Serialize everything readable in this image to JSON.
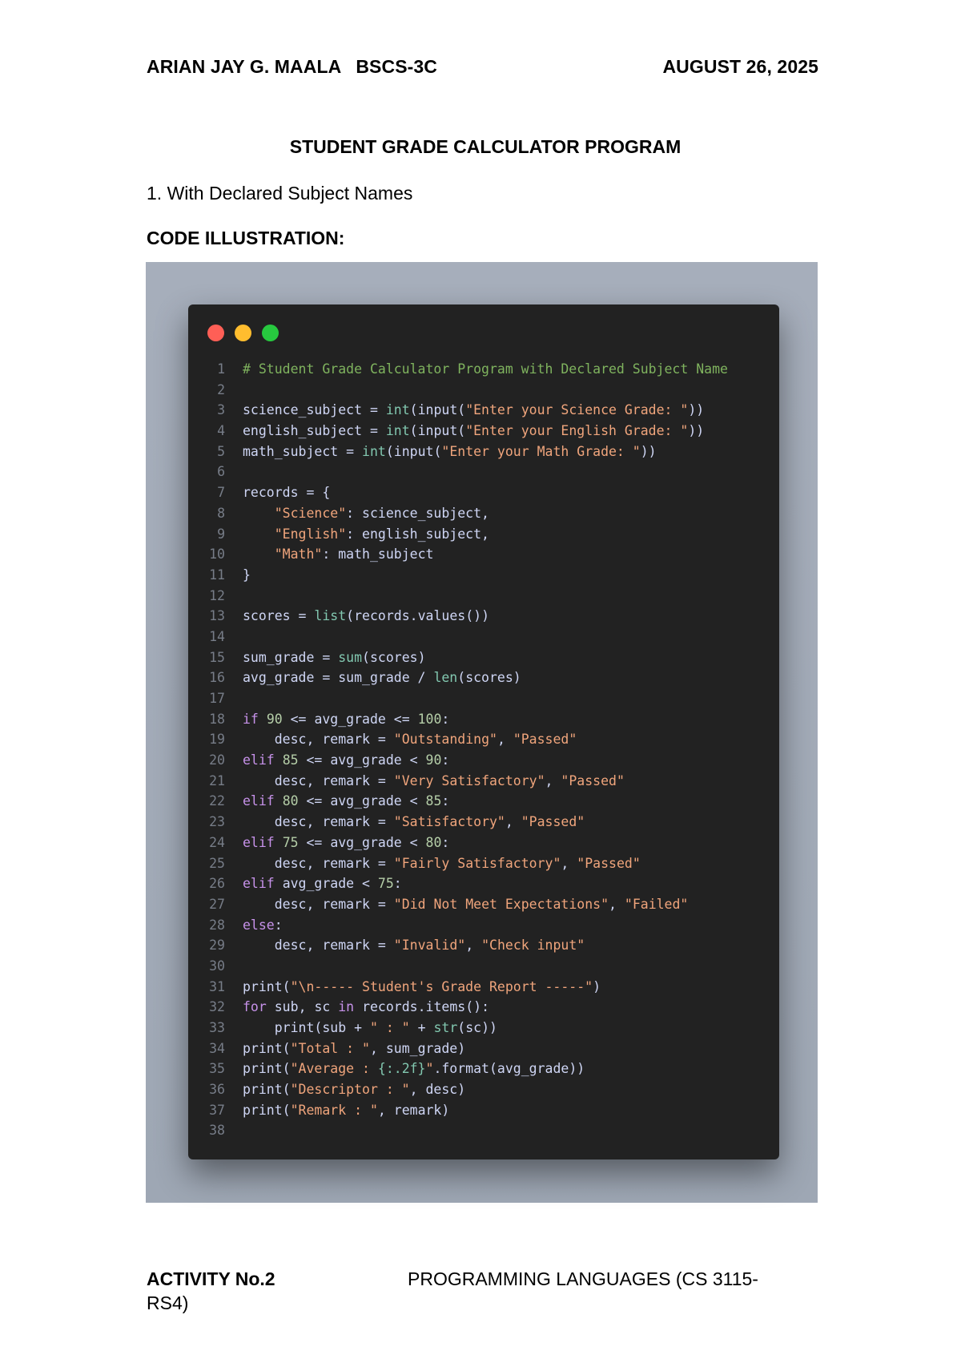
{
  "header": {
    "name": "ARIAN JAY G. MAALA",
    "course": "BSCS-3C",
    "date": "AUGUST 26, 2025"
  },
  "title": "STUDENT GRADE CALCULATOR PROGRAM",
  "section": "1. With Declared Subject Names",
  "code_heading": "CODE ILLUSTRATION:",
  "colors": {
    "window_bg": "#222222",
    "backdrop": "#a6aebb",
    "dot_red": "#ff5f56",
    "dot_yellow": "#ffbd2e",
    "dot_green": "#27c93f"
  },
  "code_lines": [
    [
      [
        "c",
        "# Student Grade Calculator Program with Declared Subject Name"
      ]
    ],
    [],
    [
      [
        "v",
        "science_subject"
      ],
      [
        "p",
        " = "
      ],
      [
        "f",
        "int"
      ],
      [
        "p",
        "("
      ],
      [
        "v",
        "input"
      ],
      [
        "p",
        "("
      ],
      [
        "s",
        "\"Enter your Science Grade: \""
      ],
      [
        "p",
        "))"
      ]
    ],
    [
      [
        "v",
        "english_subject"
      ],
      [
        "p",
        " = "
      ],
      [
        "f",
        "int"
      ],
      [
        "p",
        "("
      ],
      [
        "v",
        "input"
      ],
      [
        "p",
        "("
      ],
      [
        "s",
        "\"Enter your English Grade: \""
      ],
      [
        "p",
        "))"
      ]
    ],
    [
      [
        "v",
        "math_subject"
      ],
      [
        "p",
        " = "
      ],
      [
        "f",
        "int"
      ],
      [
        "p",
        "("
      ],
      [
        "v",
        "input"
      ],
      [
        "p",
        "("
      ],
      [
        "s",
        "\"Enter your Math Grade: \""
      ],
      [
        "p",
        "))"
      ]
    ],
    [],
    [
      [
        "v",
        "records"
      ],
      [
        "p",
        " = {"
      ]
    ],
    [
      [
        "p",
        "    "
      ],
      [
        "s",
        "\"Science\""
      ],
      [
        "p",
        ": "
      ],
      [
        "v",
        "science_subject"
      ],
      [
        "p",
        ","
      ]
    ],
    [
      [
        "p",
        "    "
      ],
      [
        "s",
        "\"English\""
      ],
      [
        "p",
        ": "
      ],
      [
        "v",
        "english_subject"
      ],
      [
        "p",
        ","
      ]
    ],
    [
      [
        "p",
        "    "
      ],
      [
        "s",
        "\"Math\""
      ],
      [
        "p",
        ": "
      ],
      [
        "v",
        "math_subject"
      ]
    ],
    [
      [
        "p",
        "}"
      ]
    ],
    [],
    [
      [
        "v",
        "scores"
      ],
      [
        "p",
        " = "
      ],
      [
        "f",
        "list"
      ],
      [
        "p",
        "("
      ],
      [
        "v",
        "records"
      ],
      [
        "p",
        "."
      ],
      [
        "v",
        "values"
      ],
      [
        "p",
        "())"
      ]
    ],
    [],
    [
      [
        "v",
        "sum_grade"
      ],
      [
        "p",
        " = "
      ],
      [
        "f",
        "sum"
      ],
      [
        "p",
        "("
      ],
      [
        "v",
        "scores"
      ],
      [
        "p",
        ")"
      ]
    ],
    [
      [
        "v",
        "avg_grade"
      ],
      [
        "p",
        " = "
      ],
      [
        "v",
        "sum_grade"
      ],
      [
        "p",
        " / "
      ],
      [
        "f",
        "len"
      ],
      [
        "p",
        "("
      ],
      [
        "v",
        "scores"
      ],
      [
        "p",
        ")"
      ]
    ],
    [],
    [
      [
        "k",
        "if"
      ],
      [
        "p",
        " "
      ],
      [
        "n",
        "90"
      ],
      [
        "p",
        " <= "
      ],
      [
        "v",
        "avg_grade"
      ],
      [
        "p",
        " <= "
      ],
      [
        "n",
        "100"
      ],
      [
        "p",
        ":"
      ]
    ],
    [
      [
        "p",
        "    "
      ],
      [
        "v",
        "desc"
      ],
      [
        "p",
        ", "
      ],
      [
        "v",
        "remark"
      ],
      [
        "p",
        " = "
      ],
      [
        "s",
        "\"Outstanding\""
      ],
      [
        "p",
        ", "
      ],
      [
        "s",
        "\"Passed\""
      ]
    ],
    [
      [
        "k",
        "elif"
      ],
      [
        "p",
        " "
      ],
      [
        "n",
        "85"
      ],
      [
        "p",
        " <= "
      ],
      [
        "v",
        "avg_grade"
      ],
      [
        "p",
        " < "
      ],
      [
        "n",
        "90"
      ],
      [
        "p",
        ":"
      ]
    ],
    [
      [
        "p",
        "    "
      ],
      [
        "v",
        "desc"
      ],
      [
        "p",
        ", "
      ],
      [
        "v",
        "remark"
      ],
      [
        "p",
        " = "
      ],
      [
        "s",
        "\"Very Satisfactory\""
      ],
      [
        "p",
        ", "
      ],
      [
        "s",
        "\"Passed\""
      ]
    ],
    [
      [
        "k",
        "elif"
      ],
      [
        "p",
        " "
      ],
      [
        "n",
        "80"
      ],
      [
        "p",
        " <= "
      ],
      [
        "v",
        "avg_grade"
      ],
      [
        "p",
        " < "
      ],
      [
        "n",
        "85"
      ],
      [
        "p",
        ":"
      ]
    ],
    [
      [
        "p",
        "    "
      ],
      [
        "v",
        "desc"
      ],
      [
        "p",
        ", "
      ],
      [
        "v",
        "remark"
      ],
      [
        "p",
        " = "
      ],
      [
        "s",
        "\"Satisfactory\""
      ],
      [
        "p",
        ", "
      ],
      [
        "s",
        "\"Passed\""
      ]
    ],
    [
      [
        "k",
        "elif"
      ],
      [
        "p",
        " "
      ],
      [
        "n",
        "75"
      ],
      [
        "p",
        " <= "
      ],
      [
        "v",
        "avg_grade"
      ],
      [
        "p",
        " < "
      ],
      [
        "n",
        "80"
      ],
      [
        "p",
        ":"
      ]
    ],
    [
      [
        "p",
        "    "
      ],
      [
        "v",
        "desc"
      ],
      [
        "p",
        ", "
      ],
      [
        "v",
        "remark"
      ],
      [
        "p",
        " = "
      ],
      [
        "s",
        "\"Fairly Satisfactory\""
      ],
      [
        "p",
        ", "
      ],
      [
        "s",
        "\"Passed\""
      ]
    ],
    [
      [
        "k",
        "elif"
      ],
      [
        "p",
        " "
      ],
      [
        "v",
        "avg_grade"
      ],
      [
        "p",
        " < "
      ],
      [
        "n",
        "75"
      ],
      [
        "p",
        ":"
      ]
    ],
    [
      [
        "p",
        "    "
      ],
      [
        "v",
        "desc"
      ],
      [
        "p",
        ", "
      ],
      [
        "v",
        "remark"
      ],
      [
        "p",
        " = "
      ],
      [
        "s",
        "\"Did Not Meet Expectations\""
      ],
      [
        "p",
        ", "
      ],
      [
        "s",
        "\"Failed\""
      ]
    ],
    [
      [
        "k",
        "else"
      ],
      [
        "p",
        ":"
      ]
    ],
    [
      [
        "p",
        "    "
      ],
      [
        "v",
        "desc"
      ],
      [
        "p",
        ", "
      ],
      [
        "v",
        "remark"
      ],
      [
        "p",
        " = "
      ],
      [
        "s",
        "\"Invalid\""
      ],
      [
        "p",
        ", "
      ],
      [
        "s",
        "\"Check input\""
      ]
    ],
    [],
    [
      [
        "v",
        "print"
      ],
      [
        "p",
        "("
      ],
      [
        "s",
        "\"\\n----- Student's Grade Report -----\""
      ],
      [
        "p",
        ")"
      ]
    ],
    [
      [
        "k",
        "for"
      ],
      [
        "p",
        " "
      ],
      [
        "v",
        "sub"
      ],
      [
        "p",
        ", "
      ],
      [
        "v",
        "sc"
      ],
      [
        "p",
        " "
      ],
      [
        "k",
        "in"
      ],
      [
        "p",
        " "
      ],
      [
        "v",
        "records"
      ],
      [
        "p",
        "."
      ],
      [
        "v",
        "items"
      ],
      [
        "p",
        "():"
      ]
    ],
    [
      [
        "p",
        "    "
      ],
      [
        "v",
        "print"
      ],
      [
        "p",
        "("
      ],
      [
        "v",
        "sub"
      ],
      [
        "p",
        " + "
      ],
      [
        "s",
        "\" : \""
      ],
      [
        "p",
        " + "
      ],
      [
        "f",
        "str"
      ],
      [
        "p",
        "("
      ],
      [
        "v",
        "sc"
      ],
      [
        "p",
        "))"
      ]
    ],
    [
      [
        "v",
        "print"
      ],
      [
        "p",
        "("
      ],
      [
        "s",
        "\"Total : \""
      ],
      [
        "p",
        ", "
      ],
      [
        "v",
        "sum_grade"
      ],
      [
        "p",
        ")"
      ]
    ],
    [
      [
        "v",
        "print"
      ],
      [
        "p",
        "("
      ],
      [
        "s",
        "\"Average : "
      ],
      [
        "f",
        "{:.2f}"
      ],
      [
        "s",
        "\""
      ],
      [
        "p",
        "."
      ],
      [
        "v",
        "format"
      ],
      [
        "p",
        "("
      ],
      [
        "v",
        "avg_grade"
      ],
      [
        "p",
        "))"
      ]
    ],
    [
      [
        "v",
        "print"
      ],
      [
        "p",
        "("
      ],
      [
        "s",
        "\"Descriptor : \""
      ],
      [
        "p",
        ", "
      ],
      [
        "v",
        "desc"
      ],
      [
        "p",
        ")"
      ]
    ],
    [
      [
        "v",
        "print"
      ],
      [
        "p",
        "("
      ],
      [
        "s",
        "\"Remark : \""
      ],
      [
        "p",
        ", "
      ],
      [
        "v",
        "remark"
      ],
      [
        "p",
        ")"
      ]
    ],
    []
  ],
  "footer": {
    "activity": "ACTIVITY No.2",
    "subject": "PROGRAMMING LANGUAGES (CS 3115-",
    "subject_wrap": "RS4)"
  }
}
